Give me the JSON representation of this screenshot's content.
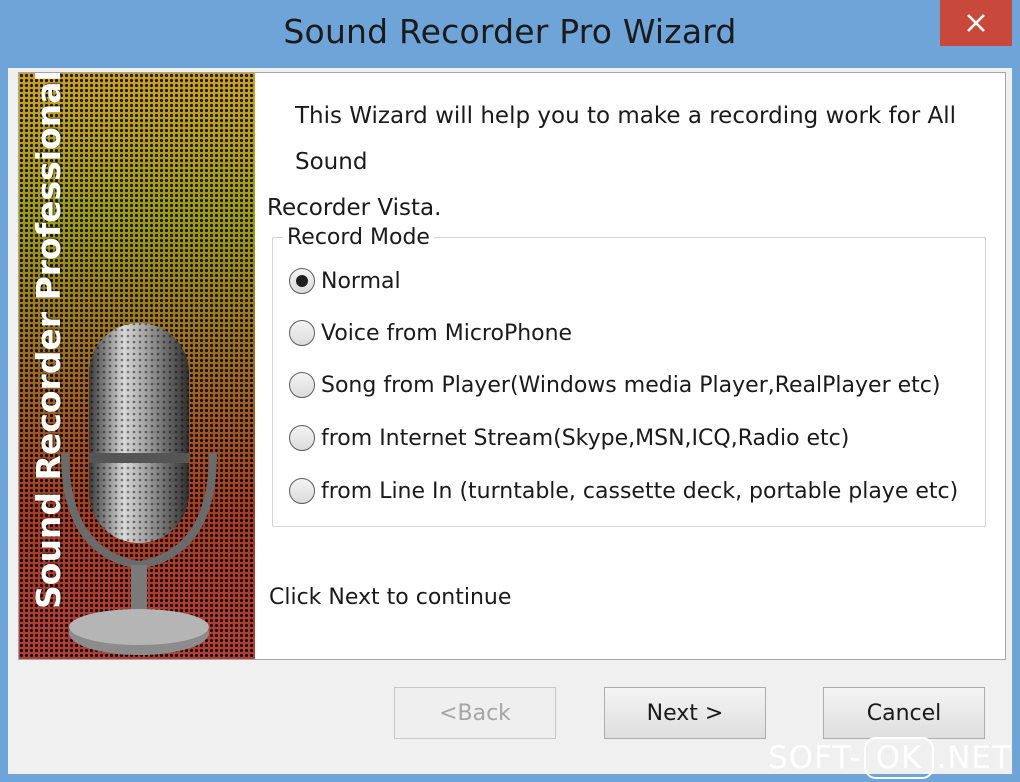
{
  "window": {
    "title": "Sound Recorder Pro Wizard"
  },
  "side_banner": {
    "text": "Sound Recorder Professional"
  },
  "intro": {
    "line1": "This Wizard will help you to make a recording work for All Sound",
    "line2": "Recorder Vista."
  },
  "record_mode": {
    "title": "Record Mode",
    "selected_index": 0,
    "options": [
      "Normal",
      "Voice from MicroPhone",
      "Song from Player(Windows media Player,RealPlayer etc)",
      "from Internet Stream(Skype,MSN,ICQ,Radio etc)",
      "from Line In (turntable, cassette deck, portable playe etc)"
    ]
  },
  "footer_text": "Click Next to continue",
  "buttons": {
    "back": "<Back",
    "next": "Next >",
    "cancel": "Cancel"
  },
  "watermark": {
    "left": "SOFT-",
    "middle": "OK",
    "right": ".NET"
  },
  "colors": {
    "titlebar": "#6fa4d8",
    "close_button": "#c9483c"
  },
  "icons": {
    "close": "close-x-icon",
    "microphone": "microphone-icon"
  }
}
